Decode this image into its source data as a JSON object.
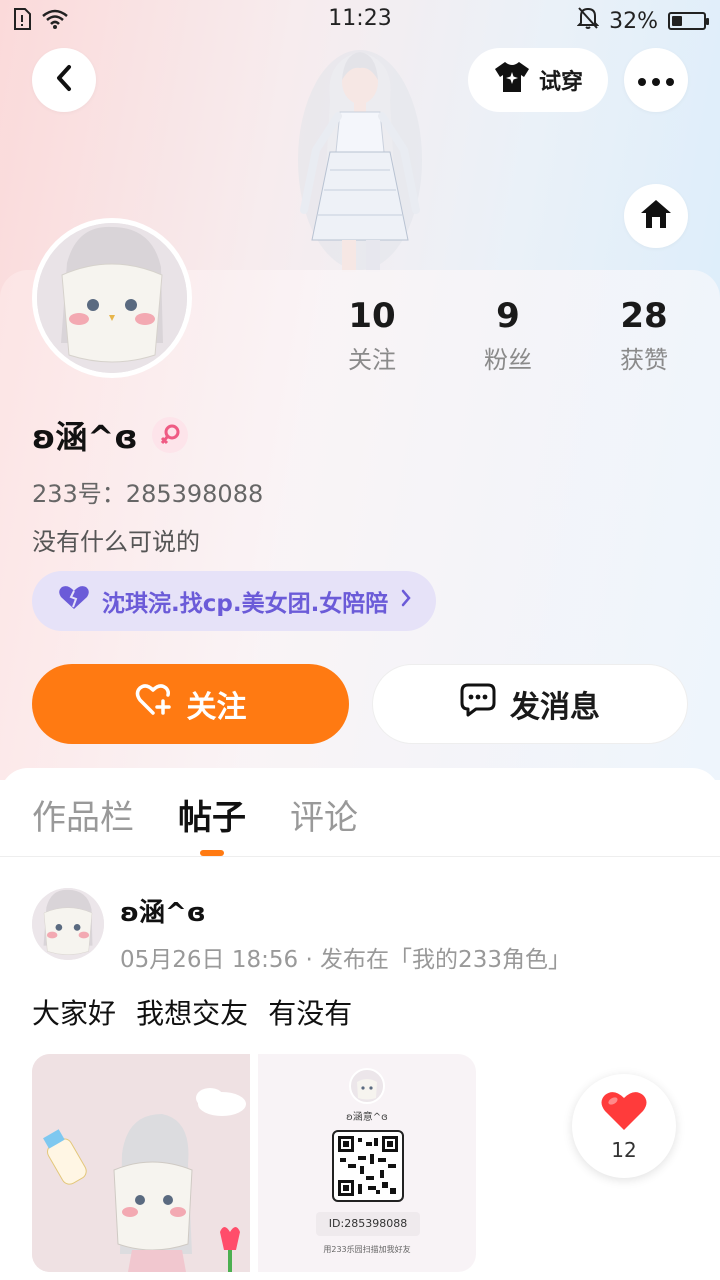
{
  "status_bar": {
    "time": "11:23",
    "battery": "32%",
    "battery_level": 0.32,
    "icons": [
      "sim-icon",
      "wifi-icon",
      "mute-bell-icon",
      "battery-icon"
    ]
  },
  "top_bar": {
    "back_icon": "chevron-left-icon",
    "tryon_label": "试穿",
    "more_icon": "more-dots-icon",
    "home_icon": "home-icon"
  },
  "profile": {
    "stats": [
      {
        "value": "10",
        "label": "关注"
      },
      {
        "value": "9",
        "label": "粉丝"
      },
      {
        "value": "28",
        "label": "获赞"
      }
    ],
    "name": "ʚ涵^ɞ",
    "gender_icon": "female-icon",
    "id_line": "233号：285398088",
    "bio": "没有什么可说的",
    "group_label": "沈琪浣.找cp.美女团.女陪陪",
    "follow_label": "关注",
    "message_label": "发消息"
  },
  "tabs": [
    {
      "label": "作品栏",
      "active": false
    },
    {
      "label": "帖子",
      "active": true
    },
    {
      "label": "评论",
      "active": false
    }
  ],
  "post": {
    "author": "ʚ涵^ɞ",
    "meta": "05月26日 18:56 · 发布在「我的233角色」",
    "text": "大家好 我想交友 有没有",
    "qr_card": {
      "name": "ʚ涵意^ɞ",
      "id": "ID:285398088",
      "hint": "用233乐园扫描加我好友"
    },
    "like_count": "12"
  },
  "colors": {
    "accent": "#ff7a12",
    "group_text": "#6b5bd8",
    "like_red": "#ff3b3b"
  }
}
